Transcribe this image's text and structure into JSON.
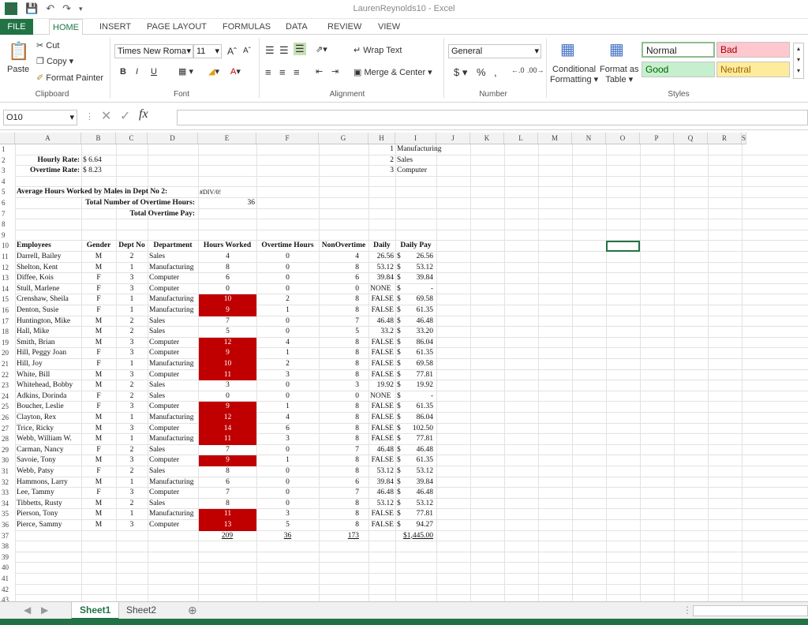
{
  "window": {
    "title": "LaurenReynolds10 - Excel"
  },
  "tabs": [
    "FILE",
    "HOME",
    "INSERT",
    "PAGE LAYOUT",
    "FORMULAS",
    "DATA",
    "REVIEW",
    "VIEW"
  ],
  "ribbon": {
    "clipboard": {
      "paste": "Paste",
      "cut": "Cut",
      "copy": "Copy",
      "format_painter": "Format Painter",
      "label": "Clipboard"
    },
    "font": {
      "name": "Times New Roma",
      "size": "11",
      "bold": "B",
      "italic": "I",
      "underline": "U",
      "label": "Font"
    },
    "alignment": {
      "wrap_text": "Wrap Text",
      "merge": "Merge & Center",
      "label": "Alignment"
    },
    "number": {
      "format": "General",
      "currency": "$",
      "percent": "%",
      "comma": ",",
      "label": "Number"
    },
    "styles": {
      "conditional": "Conditional",
      "conditional2": "Formatting",
      "format_as": "Format as",
      "format_as2": "Table",
      "normal": "Normal",
      "bad": "Bad",
      "good": "Good",
      "neutral": "Neutral",
      "label": "Styles"
    }
  },
  "formula_bar": {
    "name_box": "O10",
    "fx": "fx",
    "value": ""
  },
  "columns": [
    "A",
    "B",
    "C",
    "D",
    "E",
    "F",
    "G",
    "H",
    "I",
    "J",
    "K",
    "L",
    "M",
    "N",
    "O",
    "P",
    "Q",
    "R",
    "S"
  ],
  "info": {
    "hourly_label": "Hourly Rate:",
    "hourly_value": "$ 6.64",
    "ot_label": "Overtime Rate:",
    "ot_value": "$ 8.23",
    "avg_label": "Average Hours Worked by Males in Dept No 2:",
    "avg_value": "#DIV/0!",
    "total_ot_label": "Total Number of Overtime Hours:",
    "total_ot_value": "36",
    "total_pay_label": "Total Overtime Pay:",
    "dept_list": [
      [
        "1",
        "Manufacturing"
      ],
      [
        "2",
        "Sales"
      ],
      [
        "3",
        "Computer"
      ]
    ]
  },
  "table": {
    "headers": [
      "Employees",
      "Gender",
      "Dept No",
      "Department",
      "Hours Worked",
      "Overtime Hours",
      "NonOvertime",
      "Daily",
      "Daily Pay"
    ],
    "rows": [
      [
        "Darrell, Bailey",
        "M",
        "2",
        "Sales",
        "4",
        "0",
        "4",
        "26.56",
        "$",
        "26.56",
        false
      ],
      [
        "Shelton, Kent",
        "M",
        "1",
        "Manufacturing",
        "8",
        "0",
        "8",
        "53.12",
        "$",
        "53.12",
        false
      ],
      [
        "Diffee, Kois",
        "F",
        "3",
        "Computer",
        "6",
        "0",
        "6",
        "39.84",
        "$",
        "39.84",
        false
      ],
      [
        "Stull, Marlene",
        "F",
        "3",
        "Computer",
        "0",
        "0",
        "0",
        "NONE",
        "$",
        "-",
        false
      ],
      [
        "Crenshaw, Sheila",
        "F",
        "1",
        "Manufacturing",
        "10",
        "2",
        "8",
        "FALSE",
        "$",
        "69.58",
        true
      ],
      [
        "Denton, Susie",
        "F",
        "1",
        "Manufacturing",
        "9",
        "1",
        "8",
        "FALSE",
        "$",
        "61.35",
        true
      ],
      [
        "Huntington, Mike",
        "M",
        "2",
        "Sales",
        "7",
        "0",
        "7",
        "46.48",
        "$",
        "46.48",
        false
      ],
      [
        "Hall, Mike",
        "M",
        "2",
        "Sales",
        "5",
        "0",
        "5",
        "33.2",
        "$",
        "33.20",
        false
      ],
      [
        "Smith, Brian",
        "M",
        "3",
        "Computer",
        "12",
        "4",
        "8",
        "FALSE",
        "$",
        "86.04",
        true
      ],
      [
        "Hill, Peggy Joan",
        "F",
        "3",
        "Computer",
        "9",
        "1",
        "8",
        "FALSE",
        "$",
        "61.35",
        true
      ],
      [
        "Hill, Joy",
        "F",
        "1",
        "Manufacturing",
        "10",
        "2",
        "8",
        "FALSE",
        "$",
        "69.58",
        true
      ],
      [
        "White, Bill",
        "M",
        "3",
        "Computer",
        "11",
        "3",
        "8",
        "FALSE",
        "$",
        "77.81",
        true
      ],
      [
        "Whitehead, Bobby",
        "M",
        "2",
        "Sales",
        "3",
        "0",
        "3",
        "19.92",
        "$",
        "19.92",
        false
      ],
      [
        "Adkins, Dorinda",
        "F",
        "2",
        "Sales",
        "0",
        "0",
        "0",
        "NONE",
        "$",
        "-",
        false
      ],
      [
        "Boucher, Leslie",
        "F",
        "3",
        "Computer",
        "9",
        "1",
        "8",
        "FALSE",
        "$",
        "61.35",
        true
      ],
      [
        "Clayton, Rex",
        "M",
        "1",
        "Manufacturing",
        "12",
        "4",
        "8",
        "FALSE",
        "$",
        "86.04",
        true
      ],
      [
        "Trice, Ricky",
        "M",
        "3",
        "Computer",
        "14",
        "6",
        "8",
        "FALSE",
        "$",
        "102.50",
        true
      ],
      [
        "Webb, William W.",
        "M",
        "1",
        "Manufacturing",
        "11",
        "3",
        "8",
        "FALSE",
        "$",
        "77.81",
        true
      ],
      [
        "Carman, Nancy",
        "F",
        "2",
        "Sales",
        "7",
        "0",
        "7",
        "46.48",
        "$",
        "46.48",
        false
      ],
      [
        "Savoie, Tony",
        "M",
        "3",
        "Computer",
        "9",
        "1",
        "8",
        "FALSE",
        "$",
        "61.35",
        true
      ],
      [
        "Webb, Patsy",
        "F",
        "2",
        "Sales",
        "8",
        "0",
        "8",
        "53.12",
        "$",
        "53.12",
        false
      ],
      [
        "Hammons, Larry",
        "M",
        "1",
        "Manufacturing",
        "6",
        "0",
        "6",
        "39.84",
        "$",
        "39.84",
        false
      ],
      [
        "Lee, Tammy",
        "F",
        "3",
        "Computer",
        "7",
        "0",
        "7",
        "46.48",
        "$",
        "46.48",
        false
      ],
      [
        "Tibbetts, Rusty",
        "M",
        "2",
        "Sales",
        "8",
        "0",
        "8",
        "53.12",
        "$",
        "53.12",
        false
      ],
      [
        "Pierson, Tony",
        "M",
        "1",
        "Manufacturing",
        "11",
        "3",
        "8",
        "FALSE",
        "$",
        "77.81",
        true
      ],
      [
        "Pierce, Sammy",
        "M",
        "3",
        "Computer",
        "13",
        "5",
        "8",
        "FALSE",
        "$",
        "94.27",
        true
      ]
    ],
    "totals": {
      "hours": "209",
      "overtime": "36",
      "nonovertime": "173",
      "pay": "$1,445.00"
    }
  },
  "sheets": [
    "Sheet1",
    "Sheet2"
  ],
  "colors": {
    "accent": "#217346",
    "highlight": "#c00000"
  }
}
